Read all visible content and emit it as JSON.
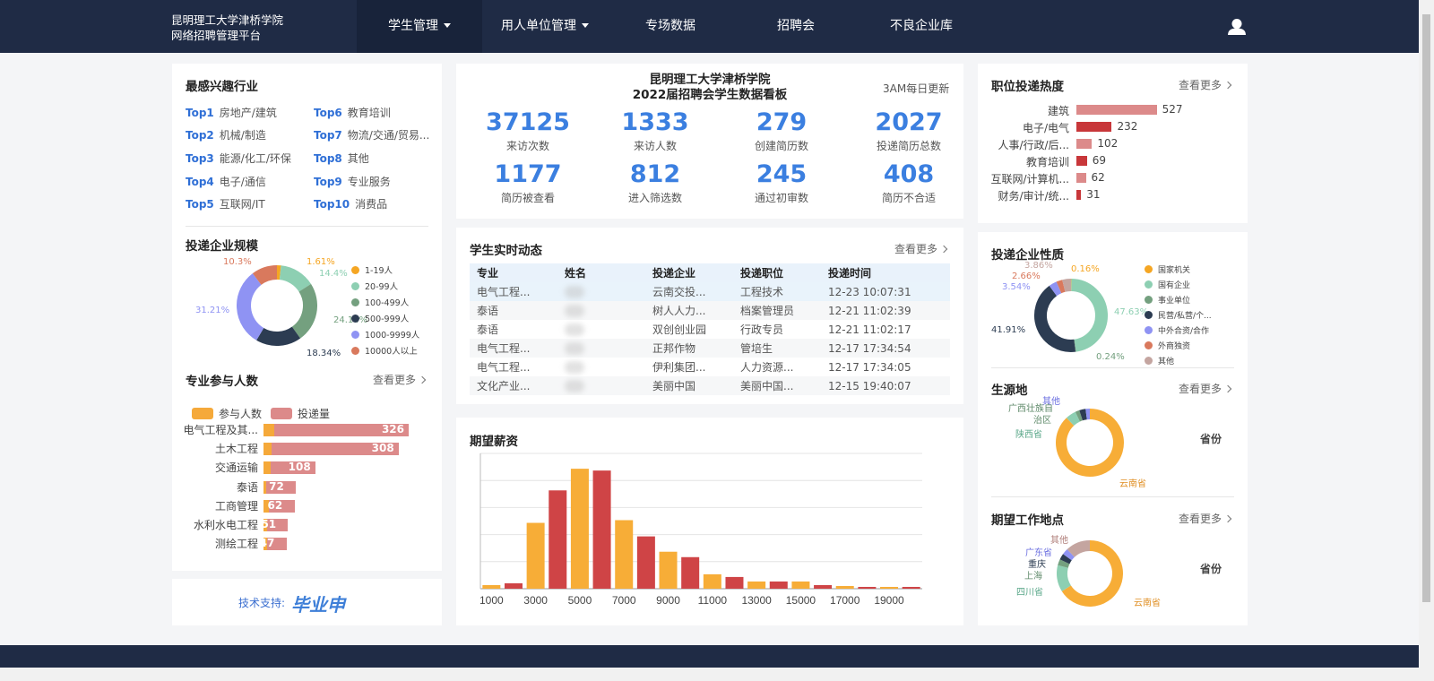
{
  "header": {
    "brand_line1": "昆明理工大学津桥学院",
    "brand_line2": "网络招聘管理平台",
    "nav": [
      {
        "label": "学生管理",
        "dropdown": true,
        "active": true
      },
      {
        "label": "用人单位管理",
        "dropdown": true,
        "active": false
      },
      {
        "label": "专场数据",
        "dropdown": false,
        "active": false
      },
      {
        "label": "招聘会",
        "dropdown": false,
        "active": false
      },
      {
        "label": "不良企业库",
        "dropdown": false,
        "active": false
      }
    ],
    "user_icon": "user-icon"
  },
  "interest_industry": {
    "title": "最感兴趣行业",
    "items": [
      {
        "rank": "Top1",
        "name": "房地产/建筑"
      },
      {
        "rank": "Top2",
        "name": "机械/制造"
      },
      {
        "rank": "Top3",
        "name": "能源/化工/环保"
      },
      {
        "rank": "Top4",
        "name": "电子/通信"
      },
      {
        "rank": "Top5",
        "name": "互联网/IT"
      },
      {
        "rank": "Top6",
        "name": "教育培训"
      },
      {
        "rank": "Top7",
        "name": "物流/交通/贸易..."
      },
      {
        "rank": "Top8",
        "name": "其他"
      },
      {
        "rank": "Top9",
        "name": "专业服务"
      },
      {
        "rank": "Top10",
        "name": "消费品"
      }
    ]
  },
  "company_scale": {
    "title": "投递企业规模",
    "chart_data": {
      "type": "pie",
      "labels": [
        "1-19人",
        "20-99人",
        "100-499人",
        "500-999人",
        "1000-9999人",
        "10000人以上"
      ],
      "values": [
        1.61,
        14.4,
        24.14,
        18.34,
        31.21,
        10.3
      ],
      "value_labels": [
        "1.61%",
        "14.4%",
        "24.14%",
        "18.34%",
        "31.21%",
        "10.3%"
      ],
      "colors": [
        "#f5a623",
        "#8dcfb2",
        "#74a07f",
        "#2c3c52",
        "#8f93f3",
        "#d9795d"
      ]
    }
  },
  "major_participation": {
    "title": "专业参与人数",
    "more": "查看更多",
    "chart_data": {
      "type": "bar",
      "orientation": "horizontal",
      "categories": [
        "电气工程及其...",
        "土木工程",
        "交通运输",
        "泰语",
        "工商管理",
        "水利水电工程",
        "测绘工程"
      ],
      "series": [
        {
          "name": "参与人数",
          "color": "#f5a93a",
          "values": [
            12,
            9,
            8,
            3,
            6,
            4,
            4
          ]
        },
        {
          "name": "投递量",
          "color": "#dc8a8a",
          "values": [
            326,
            308,
            108,
            72,
            62,
            51,
            47
          ]
        }
      ]
    }
  },
  "tech_support": {
    "label": "技术支持:",
    "logo_text": "毕业申"
  },
  "board": {
    "title_line1": "昆明理工大学津桥学院",
    "title_line2": "2022届招聘会学生数据看板",
    "update_note": "3AM每日更新",
    "stats": [
      {
        "value": "37125",
        "label": "来访次数"
      },
      {
        "value": "1333",
        "label": "来访人数"
      },
      {
        "value": "279",
        "label": "创建简历数"
      },
      {
        "value": "2027",
        "label": "投递简历总数"
      },
      {
        "value": "1177",
        "label": "简历被查看"
      },
      {
        "value": "812",
        "label": "进入筛选数"
      },
      {
        "value": "245",
        "label": "通过初审数"
      },
      {
        "value": "408",
        "label": "简历不合适"
      }
    ]
  },
  "realtime": {
    "title": "学生实时动态",
    "more": "查看更多",
    "columns": [
      "专业",
      "姓名",
      "投递企业",
      "投递职位",
      "投递时间"
    ],
    "rows": [
      [
        "电气工程...",
        "",
        "云南交投...",
        "工程技术",
        "12-23 10:07:31"
      ],
      [
        "泰语",
        "",
        "树人人力...",
        "档案管理员",
        "12-21 11:02:39"
      ],
      [
        "泰语",
        "",
        "双创创业园",
        "行政专员",
        "12-21 11:02:17"
      ],
      [
        "电气工程...",
        "",
        "正邦作物",
        "管培生",
        "12-17 17:34:54"
      ],
      [
        "电气工程...",
        "",
        "伊利集团...",
        "人力资源...",
        "12-17 17:34:05"
      ],
      [
        "文化产业...",
        "",
        "美丽中国",
        "美丽中国...",
        "12-15 19:40:07"
      ]
    ]
  },
  "salary": {
    "title": "期望薪资",
    "chart_data": {
      "type": "bar",
      "x_tick_labels": [
        "1000",
        "3000",
        "5000",
        "7000",
        "9000",
        "11000",
        "13000",
        "15000",
        "17000",
        "19000"
      ],
      "x": [
        1000,
        2000,
        3000,
        4000,
        5000,
        6000,
        7000,
        8000,
        9000,
        10000,
        11000,
        12000,
        13000,
        14000,
        15000,
        16000,
        17000,
        18000,
        19000,
        20000
      ],
      "values": [
        4,
        6,
        73,
        109,
        133,
        131,
        76,
        58,
        41,
        35,
        16,
        13,
        8,
        8,
        8,
        4,
        3,
        2,
        2,
        2
      ],
      "ylim": [
        0,
        150
      ],
      "colors": [
        "#f7ad37",
        "#cf4446"
      ],
      "grid": true
    }
  },
  "position_heat": {
    "title": "职位投递热度",
    "more": "查看更多",
    "chart_data": {
      "type": "bar",
      "orientation": "horizontal",
      "categories": [
        "建筑",
        "电子/电气",
        "人事/行政/后...",
        "教育培训",
        "互联网/计算机...",
        "财务/审计/统..."
      ],
      "values": [
        527,
        232,
        102,
        69,
        62,
        31
      ],
      "colors": [
        "#dc8a8a",
        "#c8373a",
        "#dc8a8a",
        "#c8373a",
        "#dc8a8a",
        "#c8373a"
      ]
    }
  },
  "company_nature": {
    "title": "投递企业性质",
    "chart_data": {
      "type": "pie",
      "labels": [
        "国家机关",
        "国有企业",
        "事业单位",
        "民营/私营/个...",
        "中外合资/合作",
        "外商独资",
        "其他"
      ],
      "values": [
        0.16,
        47.63,
        0.24,
        41.91,
        3.54,
        2.66,
        3.86
      ],
      "value_labels": [
        "0.16%",
        "47.63%",
        "0.24%",
        "41.91%",
        "3.54%",
        "2.66%",
        "3.86%"
      ],
      "colors": [
        "#f5a623",
        "#8dcfb2",
        "#74a07f",
        "#2c3c52",
        "#8f93f3",
        "#d9795d",
        "#c4a5a0"
      ]
    }
  },
  "origin": {
    "title": "生源地",
    "more": "查看更多",
    "side_label": "省份",
    "chart_data": {
      "type": "pie",
      "labels": [
        "云南省",
        "陕西省",
        "治区",
        "广西壮族自",
        "其他"
      ],
      "values": [
        88,
        5,
        2,
        3,
        2
      ],
      "colors": [
        "#f7ad37",
        "#8dcfb2",
        "#74a07f",
        "#2c3c52",
        "#8f93f3"
      ]
    }
  },
  "work_location": {
    "title": "期望工作地点",
    "more": "查看更多",
    "side_label": "省份",
    "chart_data": {
      "type": "pie",
      "labels": [
        "云南省",
        "四川省",
        "上海",
        "重庆",
        "广东省",
        "其他"
      ],
      "values": [
        66,
        13,
        3,
        3,
        3,
        12
      ],
      "colors": [
        "#f7ad37",
        "#8dcfb2",
        "#74a07f",
        "#2c3c52",
        "#8f93f3",
        "#c4a5a0"
      ]
    }
  }
}
